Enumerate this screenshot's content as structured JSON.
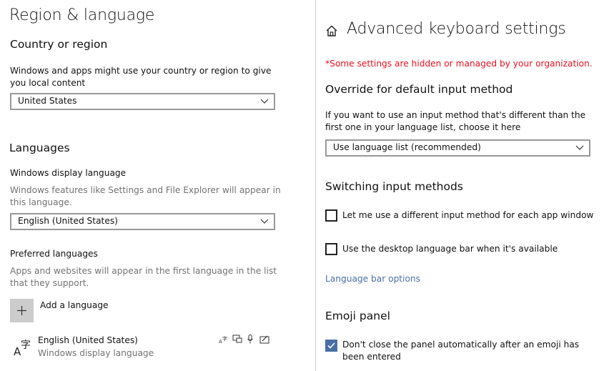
{
  "left": {
    "page_title": "Region & language",
    "country": {
      "heading": "Country or region",
      "description": "Windows and apps might use your country or region to give you local content",
      "selected": "United States"
    },
    "languages": {
      "heading": "Languages",
      "display_label": "Windows display language",
      "display_description": "Windows features like Settings and File Explorer will appear in this language.",
      "display_selected": "English (United States)",
      "preferred_label": "Preferred languages",
      "preferred_description": "Apps and websites will appear in the first language in the list that they support.",
      "add_label": "Add a language",
      "items": [
        {
          "name": "English (United States)",
          "sub": "Windows display language",
          "feature_icons": [
            "language-pack-icon",
            "speech-display-icon",
            "microphone-icon",
            "handwriting-icon"
          ]
        }
      ]
    }
  },
  "right": {
    "page_title": "Advanced keyboard settings",
    "home_icon": "home-icon",
    "managed_notice": "*Some settings are hidden or managed by your organization.",
    "override": {
      "heading": "Override for default input method",
      "description": "If you want to use an input method that's different than the first one in your language list, choose it here",
      "selected": "Use language list (recommended)"
    },
    "switching": {
      "heading": "Switching input methods",
      "options": [
        {
          "label": "Let me use a different input method for each app window",
          "checked": false
        },
        {
          "label": "Use the desktop language bar when it's available",
          "checked": false
        }
      ],
      "link": "Language bar options"
    },
    "emoji": {
      "heading": "Emoji panel",
      "option_label": "Don't close the panel automatically after an emoji has been entered",
      "checked": true
    }
  },
  "colors": {
    "notice": "#e81123",
    "link": "#4a6fa5",
    "checkbox_checked": "#4a6fa5",
    "tile": "#cccccc"
  }
}
